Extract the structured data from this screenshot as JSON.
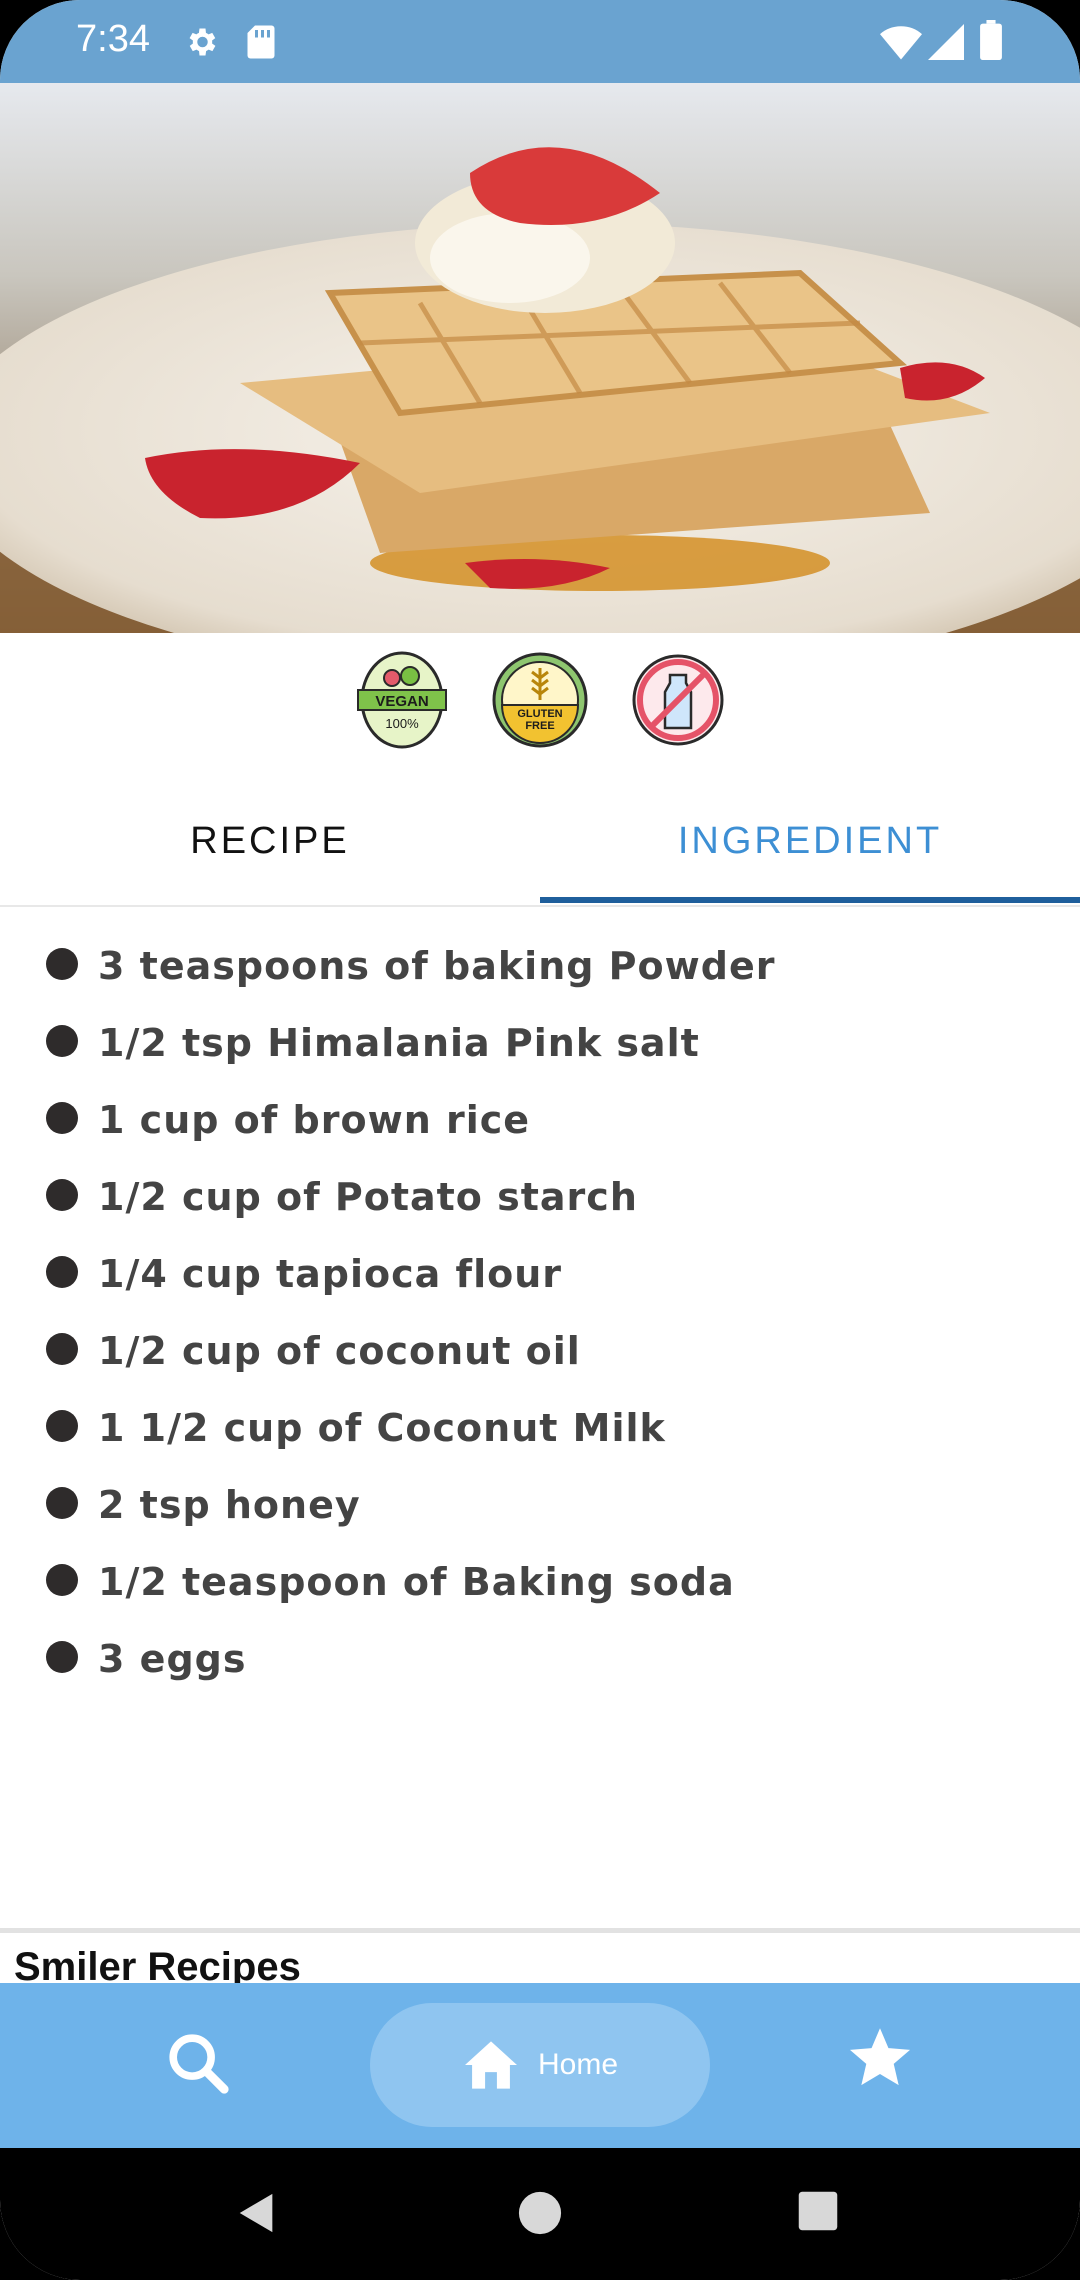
{
  "status_bar": {
    "time": "7:34",
    "icons": [
      "gear-icon",
      "sd-card-icon",
      "wifi-icon",
      "signal-icon",
      "battery-icon"
    ],
    "background": "#6aa3d0"
  },
  "hero": {
    "alt": "waffles-with-strawberries-photo"
  },
  "badges": [
    {
      "name": "vegan-badge-icon",
      "top_text": "VEGAN",
      "bottom_text": "100%"
    },
    {
      "name": "gluten-free-badge-icon",
      "top_text": "GLUTEN",
      "bottom_text": "FREE"
    },
    {
      "name": "dairy-free-badge-icon"
    }
  ],
  "tabs": [
    {
      "label": "RECIPE",
      "selected": false
    },
    {
      "label": "INGREDIENT",
      "selected": true
    }
  ],
  "ingredients": [
    "3 teaspoons of baking Powder",
    "1/2 tsp Himalania Pink salt",
    "1 cup of brown rice",
    "1/2 cup of Potato starch",
    "1/4 cup tapioca flour",
    "1/2 cup of coconut oil",
    "1 1/2 cup of Coconut Milk",
    "2 tsp honey",
    "1/2 teaspoon of Baking soda",
    "3 eggs"
  ],
  "similar": {
    "title": "Smiler Recipes"
  },
  "bottom_nav": {
    "items": [
      {
        "icon": "search-icon"
      },
      {
        "icon": "home-icon",
        "label": "Home",
        "selected": true
      },
      {
        "icon": "star-icon"
      }
    ],
    "background": "#6eb3ea"
  },
  "colors": {
    "accent": "#3d8fd4",
    "indicator": "#1f5f9c"
  }
}
